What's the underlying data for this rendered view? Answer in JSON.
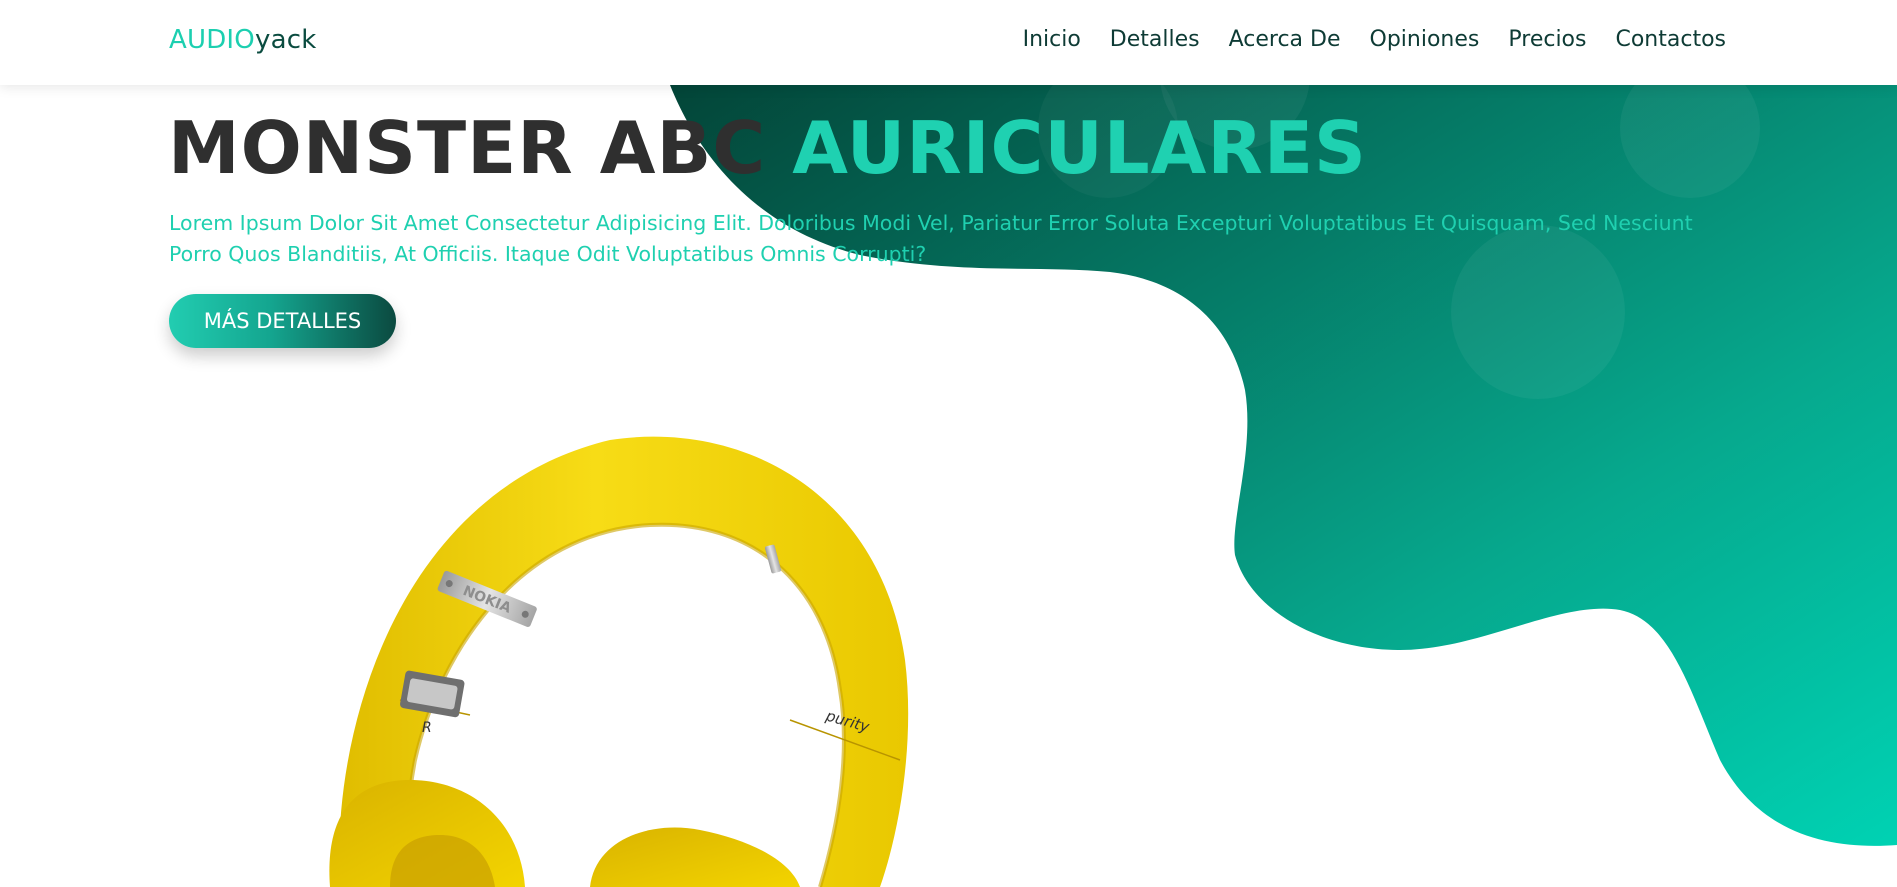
{
  "header": {
    "logo_accent": "AUDIO",
    "logo_rest": "yack",
    "nav": [
      "Inicio",
      "Detalles",
      "Acerca De",
      "Opiniones",
      "Precios",
      "Contactos"
    ]
  },
  "hero": {
    "title_dark": "MONSTER ABC ",
    "title_accent": "AURICULARES",
    "description": "Lorem Ipsum Dolor Sit Amet Consectetur Adipisicing Elit. Doloribus Modi Vel, Pariatur Error Soluta Excepturi Voluptatibus Et Quisquam, Sed Nesciunt Porro Quos Blanditiis, At Officiis. Itaque Odit Voluptatibus Omnis Corrupti?",
    "cta_label": "MÁS DETALLES"
  },
  "product": {
    "brand_label": "NOKIA",
    "side_label": "R",
    "model_label": "purity"
  },
  "colors": {
    "accent": "#1fd1b1",
    "dark_green": "#0b4c40",
    "headline": "#2f2f2f",
    "headphone_yellow": "#f2d300"
  }
}
